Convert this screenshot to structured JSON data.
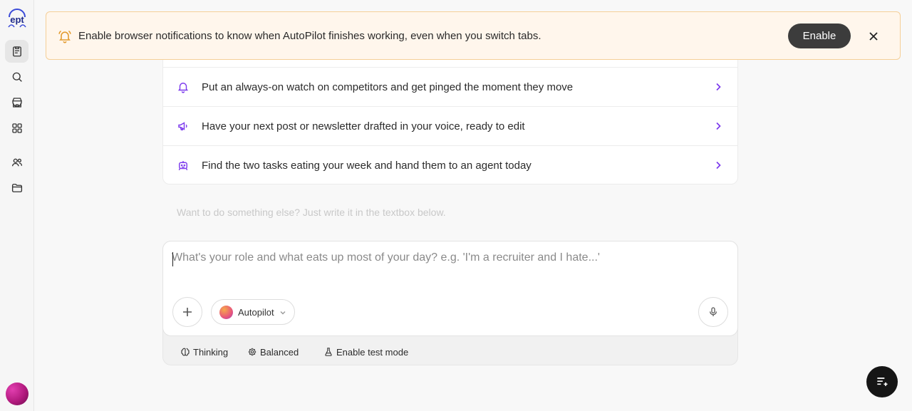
{
  "colors": {
    "accent": "#7c3aed",
    "banner_bg": "#fff6ec",
    "banner_border": "#f5cf98",
    "bell": "#e39b2f",
    "button_dark": "#3c3c3c"
  },
  "sidebar": {
    "logo_text": "ept",
    "items": [
      {
        "name": "tasks",
        "icon": "clipboard-icon",
        "active": true
      },
      {
        "name": "search",
        "icon": "search-icon",
        "active": false
      },
      {
        "name": "store",
        "icon": "store-icon",
        "active": false
      },
      {
        "name": "apps",
        "icon": "grid-icon",
        "active": false
      },
      {
        "name": "team",
        "icon": "users-icon",
        "active": false
      },
      {
        "name": "files",
        "icon": "folder-icon",
        "active": false
      }
    ]
  },
  "banner": {
    "text": "Enable browser notifications to know when AutoPilot finishes working, even when you switch tabs.",
    "enable_label": "Enable"
  },
  "suggestions": [
    {
      "text": "Put an always-on watch on competitors and get pinged the moment they move",
      "icon": "bell-icon"
    },
    {
      "text": "Have your next post or newsletter drafted in your voice, ready to edit",
      "icon": "megaphone-icon"
    },
    {
      "text": "Find the two tasks eating your week and hand them to an agent today",
      "icon": "robot-icon"
    }
  ],
  "hint": "Want to do something else? Just write it in the textbox below.",
  "composer": {
    "placeholder": "What's your role and what eats up most of your day? e.g. 'I'm a recruiter and I hate...'",
    "value": "",
    "model_label": "Autopilot"
  },
  "options": {
    "thinking": "Thinking",
    "balanced": "Balanced",
    "test_mode": "Enable test mode"
  }
}
